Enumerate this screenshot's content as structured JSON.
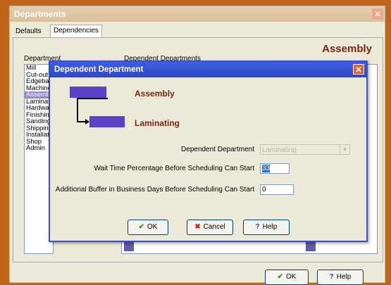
{
  "outer_window": {
    "title": "Departments",
    "close_glyph": "✕",
    "tabs": [
      {
        "label": "Defaults"
      },
      {
        "label": "Dependencies"
      }
    ],
    "heading": "Assembly",
    "department_label": "Department",
    "dependent_departments_label": "Dependent Departments",
    "departments": [
      "Mill",
      "Cut-out",
      "Edgeband",
      "Machine",
      "Assembly",
      "Laminate",
      "Hardware",
      "Finishing",
      "Sanding",
      "Shipping",
      "Installation",
      "Shop",
      "Admin"
    ],
    "selected_department_index": 4,
    "ok_label": "OK",
    "help_label": "Help"
  },
  "dialog": {
    "title": "Dependent Department",
    "close_glyph": "✕",
    "from_department": "Assembly",
    "to_department": "Laminating",
    "dependent_department_label": "Dependent Department",
    "dependent_department_value": "Laminating",
    "wait_time_label": "Wait Time Percentage Before Scheduling Can Start",
    "wait_time_value": "33",
    "buffer_label": "Additional Buffer in Business Days Before Scheduling Can Start",
    "buffer_value": "0",
    "ok_label": "OK",
    "cancel_label": "Cancel",
    "help_label": "Help"
  },
  "icons": {
    "check": "✔",
    "cross": "✖",
    "question": "?",
    "dropdown": "▼"
  },
  "colors": {
    "background": "#c0661a",
    "dialog_title": "#2f47c4",
    "dept_box": "#5b40c8",
    "dept_name": "#7a2412"
  }
}
